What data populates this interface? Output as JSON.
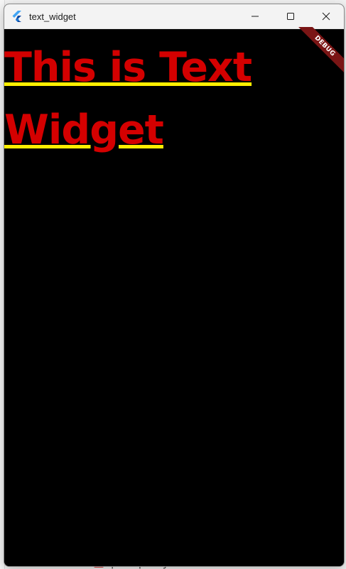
{
  "window": {
    "title": "text_widget"
  },
  "content": {
    "text": "This is Text Widget",
    "text_color": "#d40000",
    "underline_color": "#ffef00",
    "background": "#000000"
  },
  "debug_banner": {
    "label": "DEBUG"
  },
  "background_app": {
    "visible_file": "pubspec.yaml"
  },
  "icons": {
    "app": "flutter-icon",
    "minimize": "minimize-icon",
    "maximize": "maximize-icon",
    "close": "close-icon"
  }
}
